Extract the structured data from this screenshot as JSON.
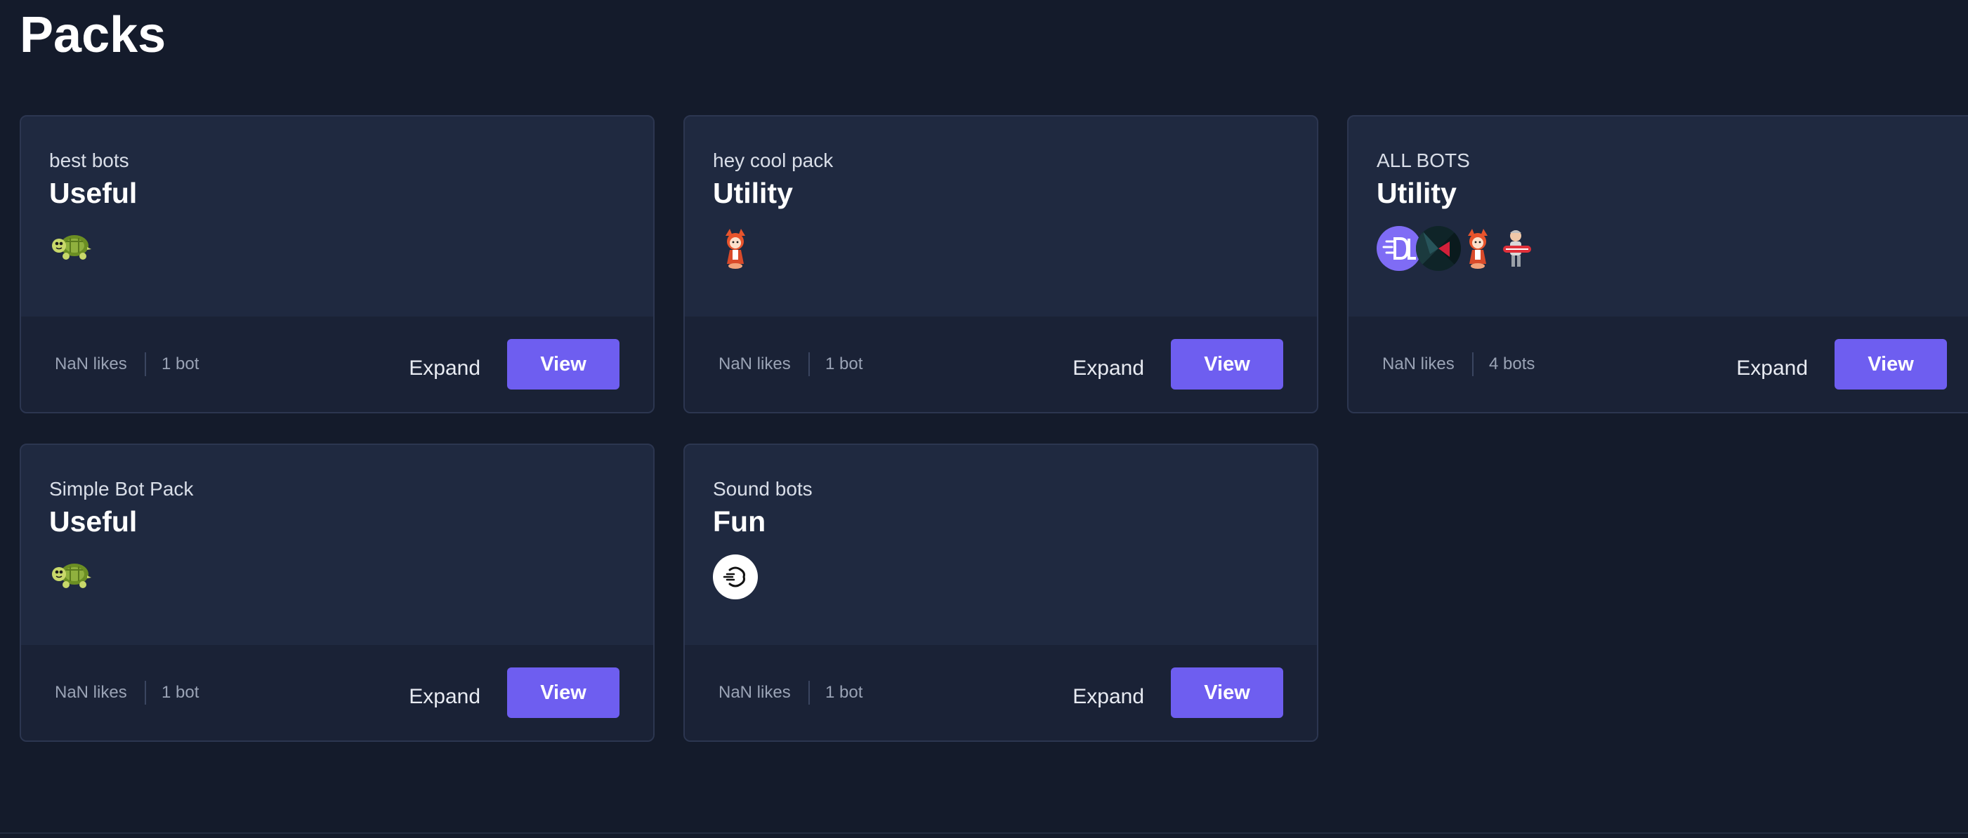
{
  "page": {
    "title": "Packs"
  },
  "colors": {
    "background": "#141b2b",
    "card": "#1f2940",
    "card_footer": "#1a2236",
    "accent": "#6e5ef0"
  },
  "packs": [
    {
      "name": "best bots",
      "category": "Useful",
      "likes": "NaN likes",
      "bots": "1 bot",
      "expand_label": "Expand",
      "view_label": "View",
      "avatars": [
        "turtle-avatar"
      ]
    },
    {
      "name": "hey cool pack",
      "category": "Utility",
      "likes": "NaN likes",
      "bots": "1 bot",
      "expand_label": "Expand",
      "view_label": "View",
      "avatars": [
        "fox-girl-avatar"
      ]
    },
    {
      "name": "ALL BOTS",
      "category": "Utility",
      "likes": "NaN likes",
      "bots": "4 bots",
      "expand_label": "Expand",
      "view_label": "View",
      "avatars": [
        "dl-logo-avatar",
        "dark-geometric-avatar",
        "fox-girl-avatar",
        "character-avatar"
      ]
    },
    {
      "name": "Simple Bot Pack",
      "category": "Useful",
      "likes": "NaN likes",
      "bots": "1 bot",
      "expand_label": "Expand",
      "view_label": "View",
      "avatars": [
        "turtle-avatar"
      ]
    },
    {
      "name": "Sound bots",
      "category": "Fun",
      "likes": "NaN likes",
      "bots": "1 bot",
      "expand_label": "Expand",
      "view_label": "View",
      "avatars": [
        "sound-wave-avatar"
      ]
    }
  ]
}
